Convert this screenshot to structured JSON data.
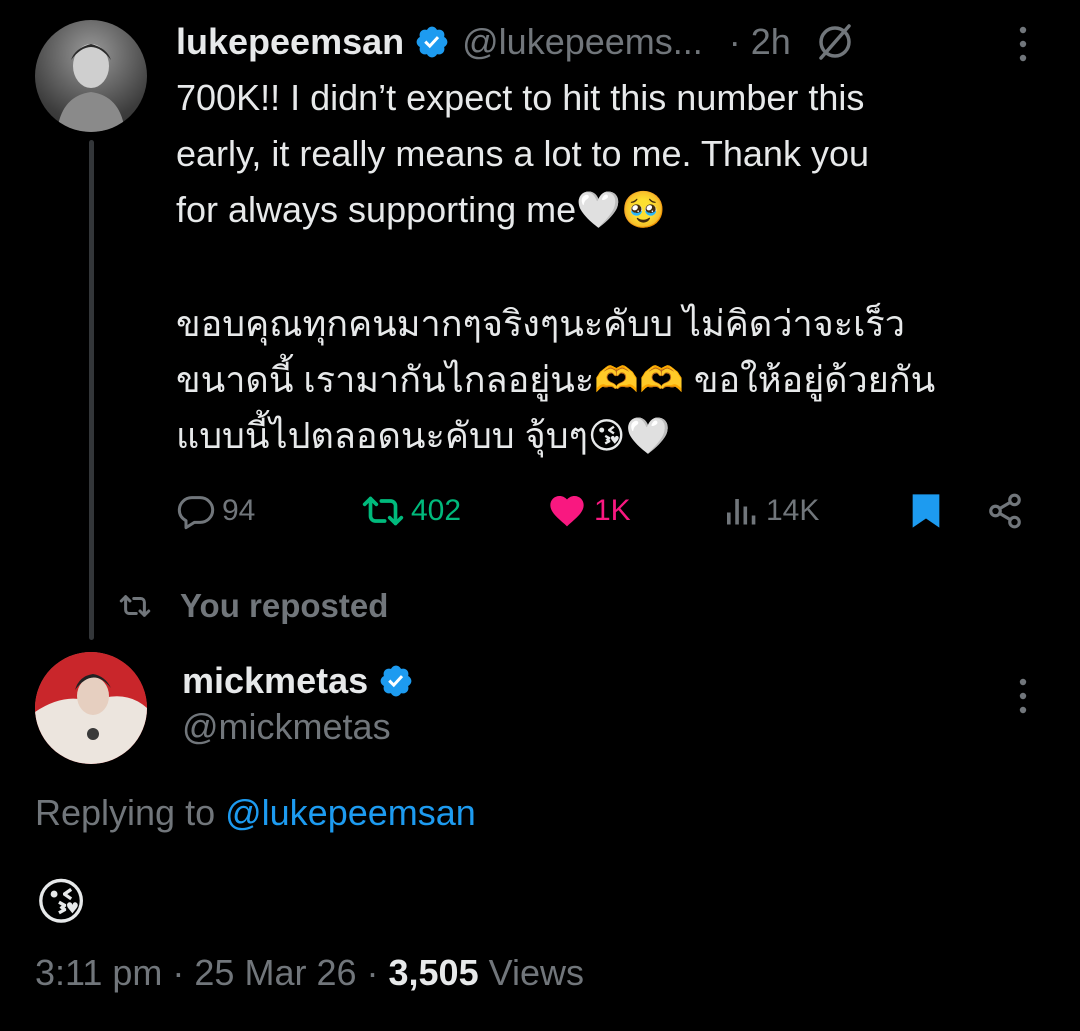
{
  "tweet1": {
    "display_name": "lukepeemsan",
    "handle": "@lukepeems...",
    "time": "· 2h",
    "body_en": "700K!! I didn’t expect to hit this number this\nearly, it really means a lot to me. Thank you\nfor always supporting me🤍🥹",
    "body_th": "ขอบคุณทุกคนมากๆจริงๆนะคับบ ไม่คิดว่าจะเร็ว\nขนาดนี้ เรามากันไกลอยู่นะ🫶🫶 ขอให้อยู่ด้วยกัน\nแบบนี้ไปตลอดนะคับบ จุ้บๆ😘🤍",
    "actions": {
      "replies": "94",
      "reposts": "402",
      "likes": "1K",
      "views": "14K"
    }
  },
  "repost_context": {
    "label": "You reposted"
  },
  "tweet2": {
    "display_name": "mickmetas",
    "handle": "@mickmetas",
    "replying_prefix": "Replying to ",
    "replying_to": "@lukepeemsan",
    "body": "😘",
    "time": "3:11 pm",
    "date": "25 Mar 26",
    "separator": " · ",
    "views_count": "3,505",
    "views_label": " Views"
  },
  "icons": {
    "verified": "verified-badge-icon",
    "grok": "grok-icon",
    "more": "more-vertical-icon",
    "reply": "reply-icon",
    "repost": "repost-icon",
    "like": "heart-icon",
    "views": "views-icon",
    "bookmark": "bookmark-icon",
    "share": "share-icon"
  },
  "colors": {
    "background": "#000000",
    "text": "#e7e9ea",
    "muted": "#71767b",
    "accent": "#1d9bf0",
    "repost_green": "#00ba7c",
    "like_pink": "#f91880"
  }
}
